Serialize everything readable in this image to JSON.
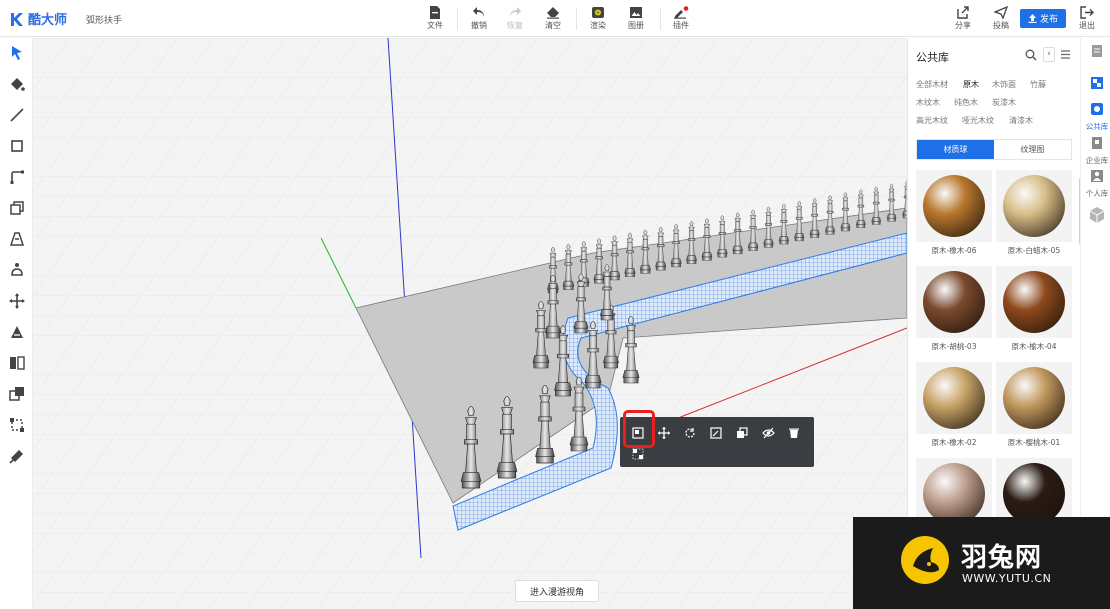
{
  "app": {
    "brand": "酷大师",
    "file_name": "弧形扶手"
  },
  "toolbar": {
    "file": "文件",
    "undo": "撤销",
    "redo": "恢复",
    "clear": "清空",
    "render": "渲染",
    "image": "图册",
    "plugin": "插件",
    "share": "分享",
    "submit": "投稿",
    "publish": "发布",
    "exit": "退出"
  },
  "viewport": {
    "walk_button": "进入漫游视角"
  },
  "library": {
    "title": "公共库",
    "categories": [
      [
        "全部木材",
        "原木",
        "木饰面",
        "竹藤"
      ],
      [
        "木纹木",
        "纯色木",
        "炭漆木"
      ],
      [
        "高光木纹",
        "哑光木纹",
        "清漆木"
      ]
    ],
    "active_category": "原木",
    "tabs": {
      "material_ball": "材质球",
      "texture": "纹理图"
    },
    "materials": [
      {
        "label": "原木-橡木-06",
        "color": "#b9782e"
      },
      {
        "label": "原木-白蜡木-05",
        "color": "#d8bf8a"
      },
      {
        "label": "原木-胡桃-03",
        "color": "#7a4a2e"
      },
      {
        "label": "原木-榆木-04",
        "color": "#8e4a1e"
      },
      {
        "label": "原木-橡木-02",
        "color": "#c9a569"
      },
      {
        "label": "原木-樱桃木-01",
        "color": "#c39a60"
      },
      {
        "label": "",
        "color": "#c0a090"
      },
      {
        "label": "",
        "color": "#2a1c14"
      }
    ]
  },
  "right_sidebar": {
    "public_lib": "公共库",
    "enterprise_lib": "企业库",
    "personal_lib": "个人库"
  },
  "watermark": {
    "name": "羽兔网",
    "url": "WWW.YUTU.CN"
  },
  "colors": {
    "accent": "#1e6fe8",
    "highlight": "#e82020",
    "mesh": "#2f7de6"
  }
}
